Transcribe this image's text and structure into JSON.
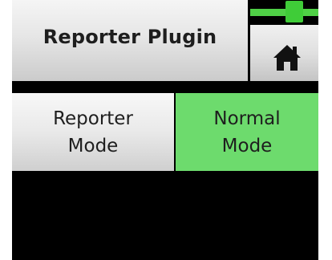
{
  "header": {
    "title": "Reporter Plugin",
    "home_icon": "home-icon"
  },
  "level": {
    "fraction": 0.7,
    "color": "#4fd046"
  },
  "modes": [
    {
      "line1": "Reporter",
      "line2": "Mode",
      "selected": false
    },
    {
      "line1": "Normal",
      "line2": "Mode",
      "selected": true
    }
  ],
  "colors": {
    "selected": "#6ddb6d",
    "background": "#000000",
    "button_light": "#e9e9e9"
  }
}
